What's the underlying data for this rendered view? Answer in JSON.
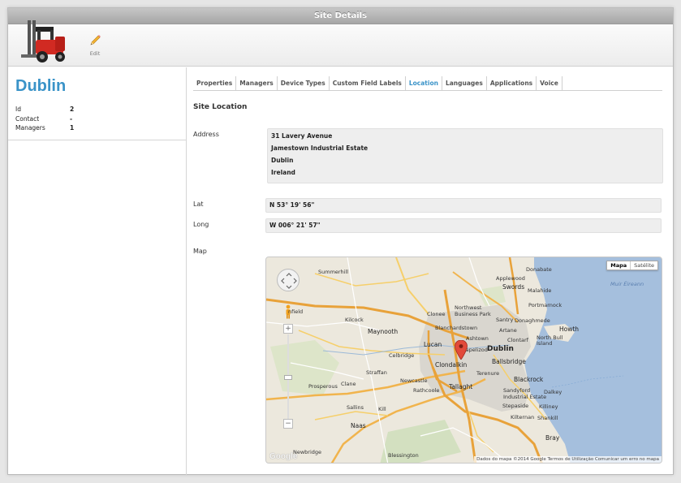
{
  "window": {
    "title": "Site Details"
  },
  "toolbar": {
    "edit_label": "Edit"
  },
  "site": {
    "name": "Dublin",
    "info": [
      {
        "label": "Id",
        "value": "2"
      },
      {
        "label": "Contact",
        "value": "-"
      },
      {
        "label": "Managers",
        "value": "1"
      }
    ]
  },
  "tabs": [
    {
      "label": "Properties",
      "active": false
    },
    {
      "label": "Managers",
      "active": false
    },
    {
      "label": "Device Types",
      "active": false
    },
    {
      "label": "Custom Field Labels",
      "active": false
    },
    {
      "label": "Location",
      "active": true
    },
    {
      "label": "Languages",
      "active": false
    },
    {
      "label": "Applications",
      "active": false
    },
    {
      "label": "Voice",
      "active": false
    }
  ],
  "location": {
    "section_title": "Site Location",
    "address_label": "Address",
    "address_lines": [
      "31 Lavery Avenue",
      "Jamestown Industrial Estate",
      "Dublin",
      "Ireland"
    ],
    "lat_label": "Lat",
    "lat_value": "N 53° 19' 56\"",
    "long_label": "Long",
    "long_value": "W 006° 21' 57\"",
    "map_label": "Map"
  },
  "map": {
    "type_buttons": [
      "Mapa",
      "Satélite"
    ],
    "attribution": "Dados do mapa ©2014 Google   Termos de Utilização   Comunicar um erro no mapa",
    "logo": "Google",
    "places": {
      "summerhill": "Summerhill",
      "donabate": "Donabate",
      "applewood": "Applewood",
      "swords": "Swords",
      "malahide": "Malahide",
      "muir_eireann": "Muir Éireann",
      "portmarnock": "Portmarnock",
      "northwest": "Northwest\nBusiness Park",
      "clonee": "Clonee",
      "santry": "Santry",
      "donaghmede": "Donaghmede",
      "kilcock": "Kilcock",
      "blanchardstown": "Blanchardstown",
      "artane": "Artane",
      "howth": "Howth",
      "maynooth": "Maynooth",
      "ashtown": "Ashtown",
      "clontarf": "Clontarf",
      "north_bull": "North Bull\nIsland",
      "lucan": "Lucan",
      "dublin": "Dublin",
      "chapelizod": "Chapelizod",
      "celbridge": "Celbridge",
      "clondalkin": "Clondalkin",
      "ballsbridge": "Ballsbridge",
      "straffan": "Straffan",
      "terenure": "Terenure",
      "newcastle": "Newcastle",
      "blackrock": "Blackrock",
      "prosperous": "Prosperous",
      "clane": "Clane",
      "rathcoole": "Rathcoole",
      "tallaght": "Tallaght",
      "sandyford": "Sandyford\nIndustrial Estate",
      "dalkey": "Dalkey",
      "stepaside": "Stepaside",
      "sallins": "Sallins",
      "kill": "Kill",
      "killiney": "Killiney",
      "naas": "Naas",
      "kilternan": "Kilternan",
      "shankill": "Shankill",
      "enfield": "nfield",
      "newbridge": "Newbridge",
      "blessington": "Blessington",
      "bray": "Bray"
    }
  }
}
